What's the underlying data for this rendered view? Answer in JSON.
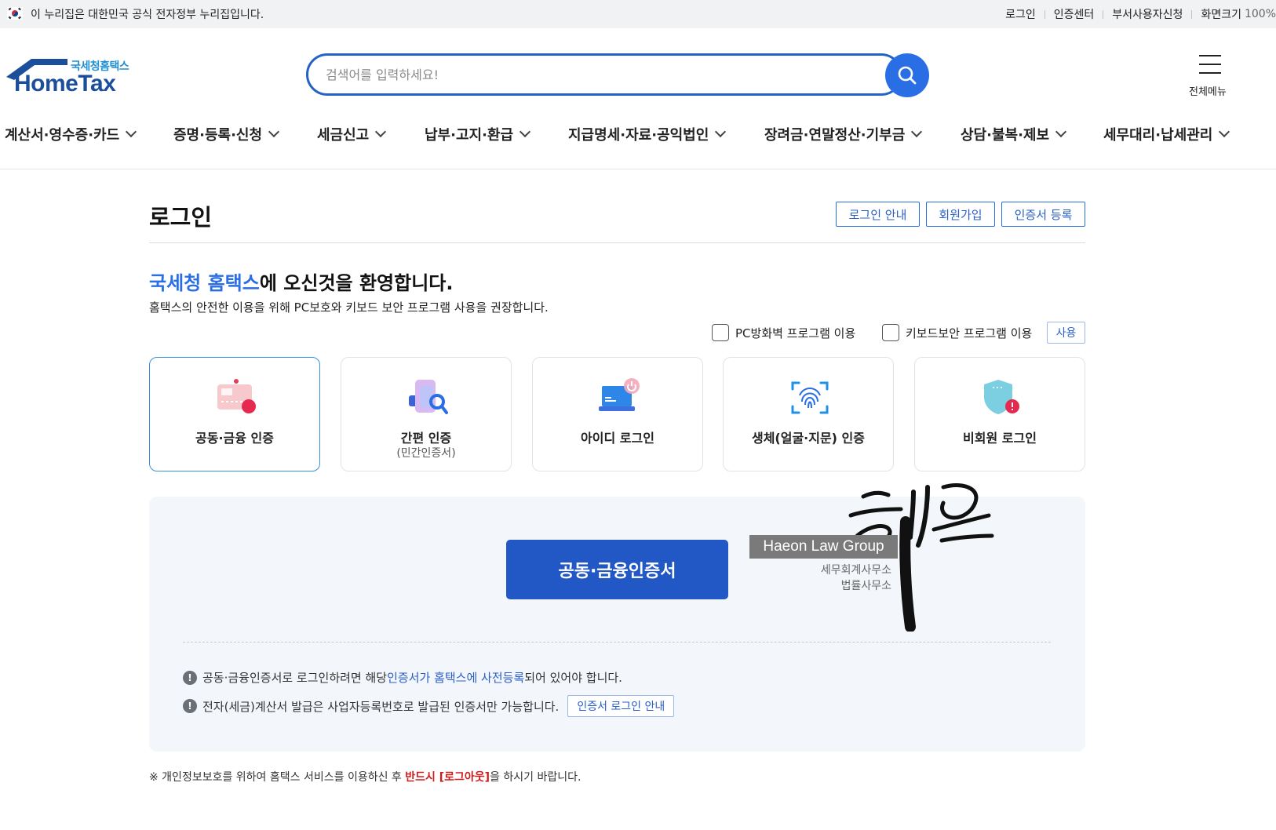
{
  "gov_banner": {
    "text": "이 누리집은 대한민국 공식 전자정부 누리집입니다.",
    "util_links": [
      "로그인",
      "인증센터",
      "부서사용자신청",
      "화면크기"
    ],
    "zoom_value": "100%"
  },
  "logo": {
    "sub": "국세청홈택스",
    "main": "HomeTax"
  },
  "search": {
    "placeholder": "검색어를 입력하세요!"
  },
  "all_menu_label": "전체메뉴",
  "gnb": [
    "계산서·영수증·카드",
    "증명·등록·신청",
    "세금신고",
    "납부·고지·환급",
    "지급명세·자료·공익법인",
    "장려금·연말정산·기부금",
    "상담·불복·제보",
    "세무대리·납세관리"
  ],
  "page": {
    "title": "로그인",
    "buttons": [
      "로그인 안내",
      "회원가입",
      "인증서 등록"
    ]
  },
  "welcome": {
    "highlight": "국세청 홈택스",
    "rest": "에 오신것을 환영합니다.",
    "sub": "홈택스의 안전한 이용을 위해 PC보호와 키보드 보안 프로그램 사용을 권장합니다."
  },
  "options": {
    "firewall": "PC방화벽 프로그램 이용",
    "keyboard": "키보드보안 프로그램 이용",
    "use_button": "사용"
  },
  "login_cards": [
    {
      "title": "공동·금융 인증",
      "sub": "",
      "icon": "certificate-icon"
    },
    {
      "title": "간편 인증",
      "sub": "(민간인증서)",
      "icon": "simple-auth-icon"
    },
    {
      "title": "아이디 로그인",
      "sub": "",
      "icon": "laptop-power-icon"
    },
    {
      "title": "생체(얼굴·지문) 인증",
      "sub": "",
      "icon": "fingerprint-icon"
    },
    {
      "title": "비회원 로그인",
      "sub": "",
      "icon": "shield-alert-icon"
    }
  ],
  "panel": {
    "main_button": "공동·금융인증서",
    "note1_pre": "공동·금융인증서로 로그인하려면 해당 ",
    "note1_link": "인증서가 홈택스에 사전등록",
    "note1_post": "되어 있어야 합니다.",
    "note2": "전자(세금)계산서 발급은 사업자등록번호로 발급된 인증서만 가능합니다.",
    "note2_button": "인증서 로그인 안내",
    "note_icon": "!"
  },
  "footnote": {
    "pre": "※ 개인정보보호를 위하여 홈택스 서비스를 이용하신 후 ",
    "red": "반드시 [로그아웃]",
    "post": "을 하시기 바랍니다."
  },
  "watermark": {
    "title": "Haeon Law Group",
    "line1": "세무회계사무소",
    "line2": "법률사무소",
    "calligraphy": "해온"
  },
  "colors": {
    "accent": "#2a6ee6",
    "primary_button": "#2158c6",
    "panel_bg": "#f3f6fa",
    "warning_red": "#d21b1b"
  }
}
